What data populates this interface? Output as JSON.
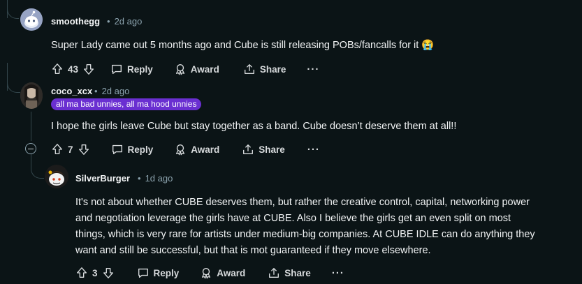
{
  "comments": [
    {
      "username": "smoothegg",
      "separator": "•",
      "time": "2d ago",
      "body": "Super Lady came out 5 months ago and Cube is still releasing POBs/fancalls for it 😭",
      "votes": "43",
      "reply_label": "Reply",
      "award_label": "Award",
      "share_label": "Share",
      "more_label": "···"
    },
    {
      "username": "coco_xcx",
      "separator": "•",
      "time": "2d ago",
      "flair": "all ma bad unnies, all ma hood unnies",
      "body": "I hope the girls leave Cube but stay together as a band. Cube doesn’t deserve them at all!!",
      "votes": "7",
      "reply_label": "Reply",
      "award_label": "Award",
      "share_label": "Share",
      "more_label": "···"
    },
    {
      "username": "SilverBurger",
      "separator": "•",
      "time": "1d ago",
      "body_lines": [
        "It's not about whether CUBE deserves them, but rather the creative control, capital, networking power",
        "and negotiation leverage the girls have at CUBE. Also I believe the girls get an even split on most",
        "things, which is very rare for artists under medium-big companies. At CUBE IDLE can do anything they",
        "want and still be successful, but that is mot guaranteed if they move elsewhere."
      ],
      "votes": "3",
      "reply_label": "Reply",
      "award_label": "Award",
      "share_label": "Share",
      "more_label": "···"
    }
  ],
  "colors": {
    "background": "#0b1416",
    "flair": "#6a2fd1",
    "thread_line": "#33464c"
  }
}
